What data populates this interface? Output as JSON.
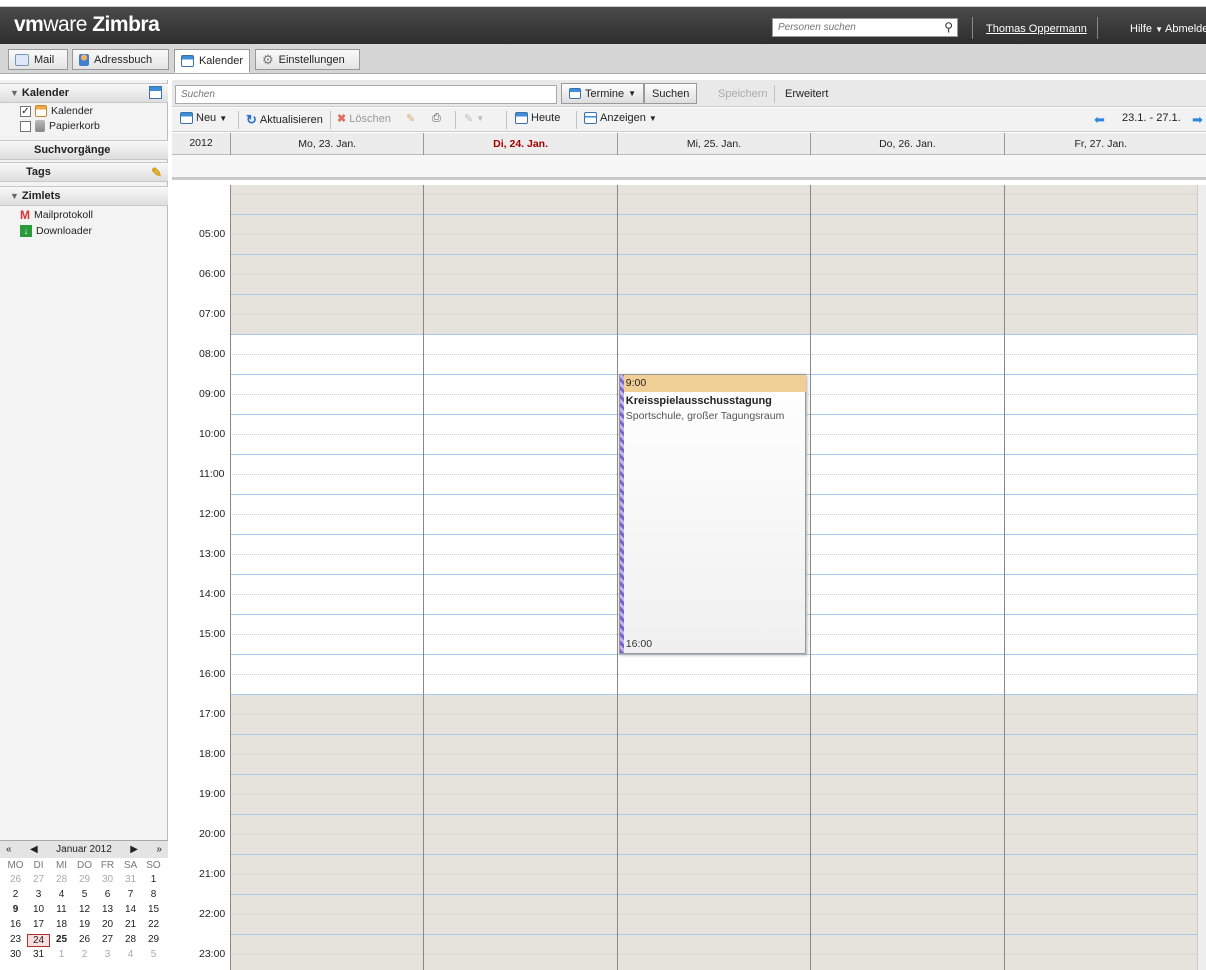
{
  "brand": {
    "vm": "vm",
    "ware": "ware",
    "product": "Zimbra"
  },
  "top": {
    "people_search_placeholder": "Personen suchen",
    "user": "Thomas Oppermann",
    "help": "Hilfe",
    "logout": "Abmelden"
  },
  "app_tabs": [
    {
      "label": "Mail"
    },
    {
      "label": "Adressbuch"
    },
    {
      "label": "Kalender"
    },
    {
      "label": "Einstellungen"
    }
  ],
  "sidebar": {
    "calendar_header": "Kalender",
    "calendars": [
      {
        "label": "Kalender",
        "checked": true
      },
      {
        "label": "Papierkorb",
        "checked": false
      }
    ],
    "searches_header": "Suchvorgänge",
    "tags_header": "Tags",
    "zimlets_header": "Zimlets",
    "zimlets": [
      {
        "label": "Mailprotokoll"
      },
      {
        "label": "Downloader"
      }
    ]
  },
  "minical": {
    "month": "Januar 2012",
    "weekdays": [
      "MO",
      "DI",
      "MI",
      "DO",
      "FR",
      "SA",
      "SO"
    ],
    "weeks": [
      [
        "26",
        "27",
        "28",
        "29",
        "30",
        "31",
        "1"
      ],
      [
        "2",
        "3",
        "4",
        "5",
        "6",
        "7",
        "8"
      ],
      [
        "9",
        "10",
        "11",
        "12",
        "13",
        "14",
        "15"
      ],
      [
        "16",
        "17",
        "18",
        "19",
        "20",
        "21",
        "22"
      ],
      [
        "23",
        "24",
        "25",
        "26",
        "27",
        "28",
        "29"
      ],
      [
        "30",
        "31",
        "1",
        "2",
        "3",
        "4",
        "5"
      ]
    ],
    "today": "24"
  },
  "search": {
    "placeholder": "Suchen",
    "type": "Termine",
    "search_btn": "Suchen",
    "save_btn": "Speichern",
    "advanced": "Erweitert"
  },
  "toolbar": {
    "new": "Neu",
    "refresh": "Aktualisieren",
    "delete": "Löschen",
    "today": "Heute",
    "view": "Anzeigen",
    "range": "23.1. - 27.1."
  },
  "calendar": {
    "year": "2012",
    "days": [
      {
        "label": "Mo, 23. Jan.",
        "today": false
      },
      {
        "label": "Di, 24. Jan.",
        "today": true
      },
      {
        "label": "Mi, 25. Jan.",
        "today": false
      },
      {
        "label": "Do, 26. Jan.",
        "today": false
      },
      {
        "label": "Fr, 27. Jan.",
        "today": false
      }
    ],
    "hours": [
      "05:00",
      "06:00",
      "07:00",
      "08:00",
      "09:00",
      "10:00",
      "11:00",
      "12:00",
      "13:00",
      "14:00",
      "15:00",
      "16:00",
      "17:00",
      "18:00",
      "19:00",
      "20:00",
      "21:00",
      "22:00",
      "23:00"
    ],
    "work_start": "08:00",
    "work_end": "17:00"
  },
  "appointment": {
    "start": "9:00",
    "end": "16:00",
    "title": "Kreisspielausschusstagung",
    "location": "Sportschule, großer Tagungsraum",
    "day": "Mi, 25. Jan."
  },
  "colors": {
    "appointment_header": "#f0cf95",
    "today_text": "#a30000",
    "nonwork": "#e5e3dc",
    "hour_line": "#a9c9e8"
  }
}
